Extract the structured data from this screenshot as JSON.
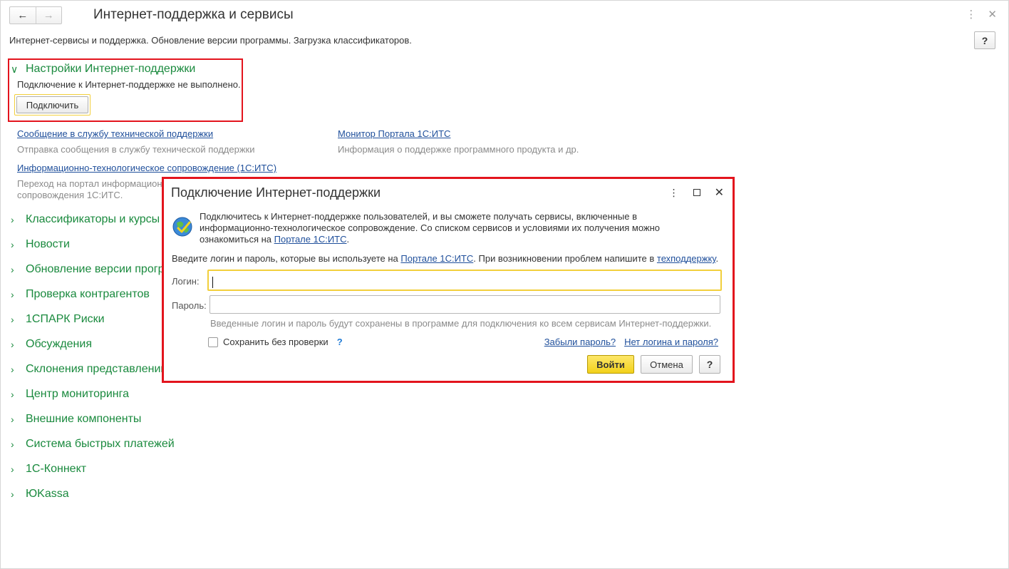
{
  "window": {
    "title": "Интернет-поддержка и сервисы",
    "subtitle": "Интернет-сервисы и поддержка. Обновление версии программы. Загрузка классификаторов.",
    "help_label": "?",
    "back_icon": "arrow-left-icon",
    "forward_icon": "arrow-right-icon",
    "more_icon": "kebab-menu-icon",
    "close_icon": "close-icon"
  },
  "settings_section": {
    "header": "Настройки Интернет-поддержки",
    "status": "Подключение к Интернет-поддержке не выполнено.",
    "connect_label": "Подключить"
  },
  "links": [
    {
      "label": "Сообщение в службу технической поддержки",
      "description": "Отправка сообщения в службу технической поддержки"
    },
    {
      "label": "Монитор Портала 1С:ИТС",
      "description": "Информация о поддержке программного продукта и др."
    },
    {
      "label": "Информационно-технологическое сопровождение (1С:ИТС)",
      "description_line1": "Переход на портал информационно-технологического",
      "description_line2": "сопровождения 1С:ИТС."
    }
  ],
  "sections": [
    "Классификаторы и курсы валют",
    "Новости",
    "Обновление версии программы",
    "Проверка контрагентов",
    "1СПАРК Риски",
    "Обсуждения",
    "Склонения представлений объектов",
    "Центр мониторинга",
    "Внешние компоненты",
    "Система быстрых платежей",
    "1С-Коннект",
    "ЮKassa"
  ],
  "dialog": {
    "title": "Подключение Интернет-поддержки",
    "info_part1": "Подключитесь к Интернет-поддержке пользователей, и вы сможете получать сервисы, включенные в",
    "info_part2": "информационно-технологическое сопровождение. Со списком сервисов и условиями их получения можно",
    "info_part3": "ознакомиться на ",
    "info_link": "Портале 1С:ИТС",
    "info_end": ".",
    "hint_part1": "Введите логин и пароль, которые вы используете на ",
    "hint_link1": "Портале 1С:ИТС",
    "hint_part2": ". При возникновении проблем напишите в ",
    "hint_link2": "техподдержку",
    "hint_end": ".",
    "login_label": "Логин:",
    "login_value": "",
    "password_label": "Пароль:",
    "password_value": "",
    "note": "Введенные логин и пароль будут сохранены в программе для подключения ко всем сервисам Интернет-поддержки.",
    "save_checkbox_label": "Сохранить без проверки",
    "save_checkbox_checked": false,
    "save_help": "?",
    "forgot_password": "Забыли пароль?",
    "no_login": "Нет логина и пароля?",
    "login_button": "Войти",
    "cancel_button": "Отмена",
    "help_button": "?"
  },
  "colors": {
    "accent_green": "#1a8a3e",
    "link_blue": "#1f4f9b",
    "highlight_red": "#e3141d",
    "focus_yellow": "#f2cf3c",
    "primary_button": "#f2d11a"
  }
}
